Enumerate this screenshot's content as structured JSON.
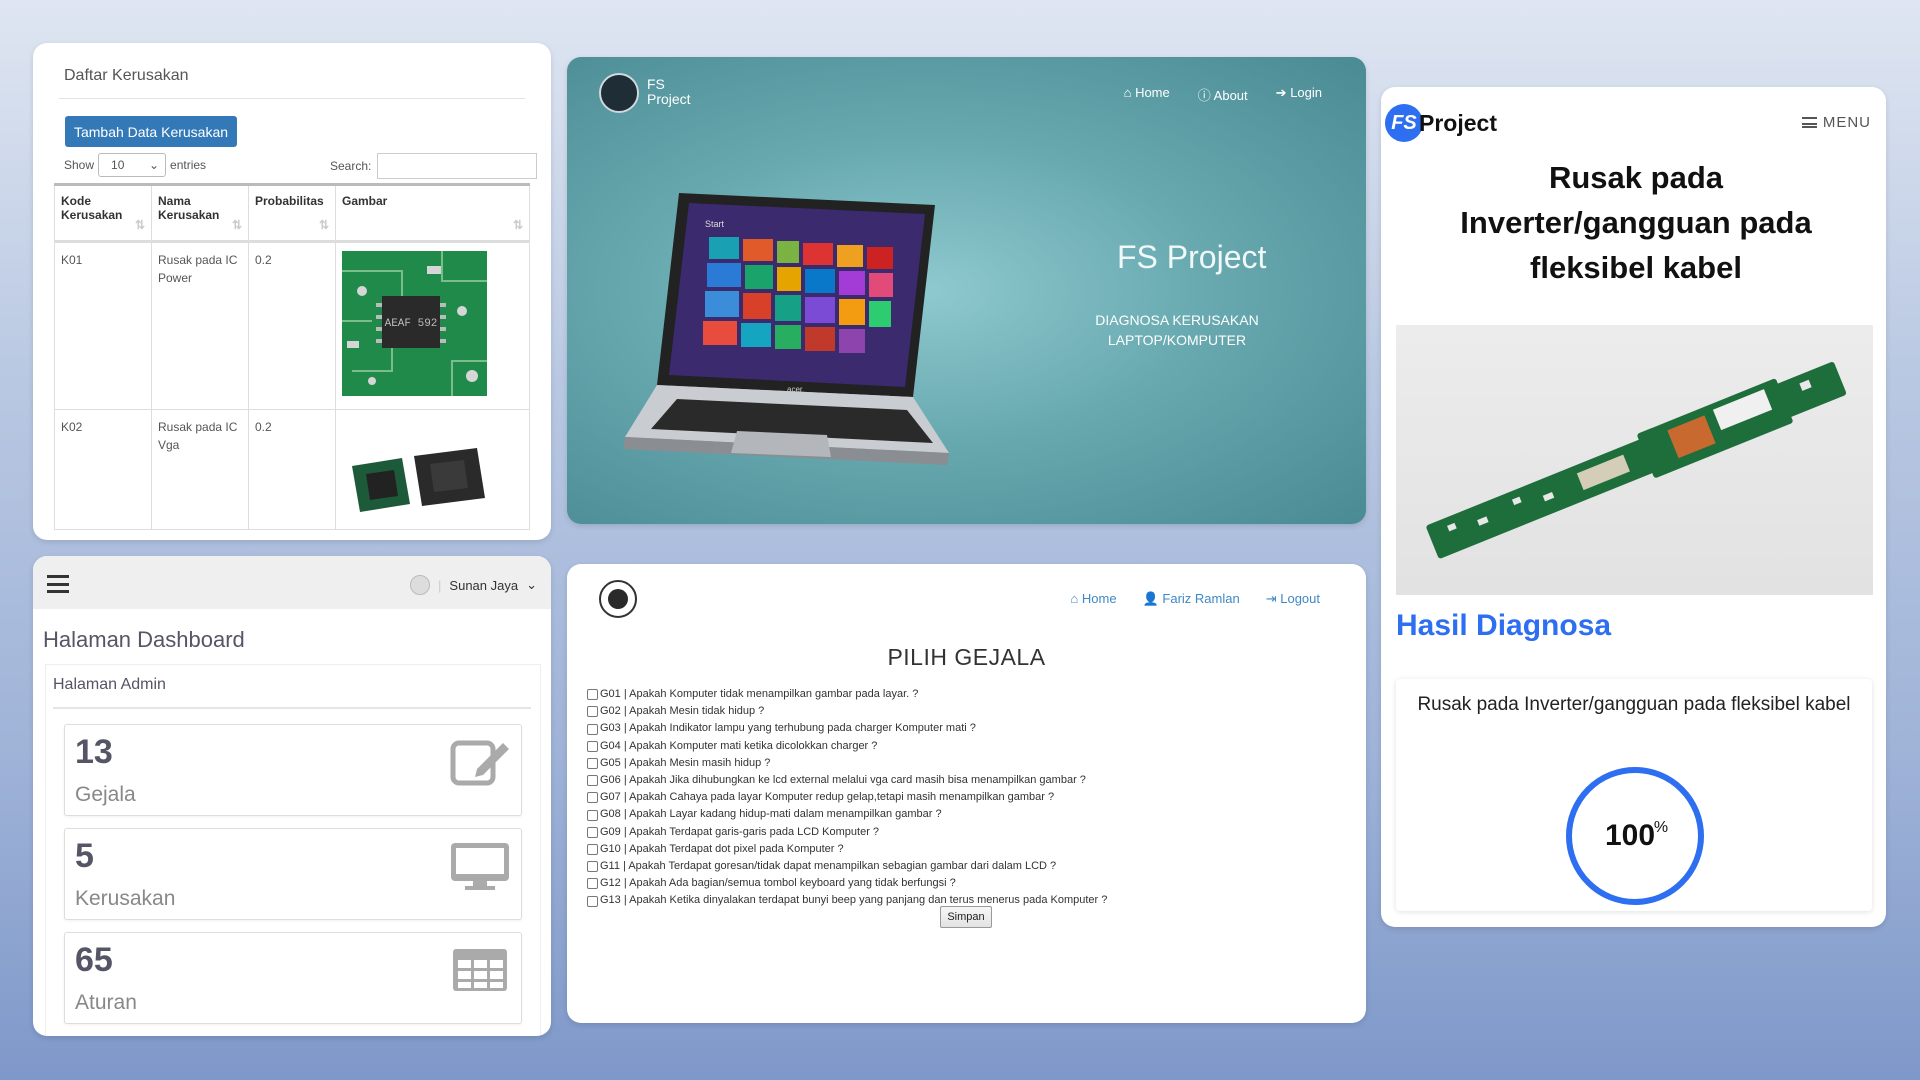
{
  "table_card": {
    "title": "Daftar Kerusakan",
    "add_button": "Tambah Data Kerusakan",
    "show_label": "Show",
    "show_value": "10",
    "entries_label": "entries",
    "search_label": "Search:",
    "columns": [
      "Kode Kerusakan",
      "Nama Kerusakan",
      "Probabilitas",
      "Gambar"
    ],
    "rows": [
      {
        "kode": "K01",
        "nama": "Rusak pada IC Power",
        "prob": "0.2",
        "chip_text": "AEAF 592"
      },
      {
        "kode": "K02",
        "nama": "Rusak pada IC Vga",
        "prob": "0.2"
      }
    ]
  },
  "hero_card": {
    "brand_line1": "FS",
    "brand_line2": "Project",
    "nav": [
      "Home",
      "About",
      "Login"
    ],
    "title": "FS Project",
    "subtitle_line1": "DIAGNOSA KERUSAKAN",
    "subtitle_line2": "LAPTOP/KOMPUTER",
    "laptop_brand": "acer",
    "screen_text": "Start"
  },
  "result_card": {
    "logo_letters": "FS",
    "logo_word": "Project",
    "menu_label": "MENU",
    "title": "Rusak pada Inverter/gangguan pada fleksibel kabel",
    "hasil_label": "Hasil Diagnosa",
    "result_text": "Rusak pada Inverter/gangguan pada fleksibel kabel",
    "percent": "100",
    "percent_sign": "%",
    "percent_fraction": 1.0,
    "accent": "#2d6ff0"
  },
  "dashboard_card": {
    "user": "Sunan Jaya",
    "title": "Halaman Dashboard",
    "subtitle": "Halaman Admin",
    "stats": [
      {
        "value": "13",
        "label": "Gejala",
        "icon": "edit-icon"
      },
      {
        "value": "5",
        "label": "Kerusakan",
        "icon": "monitor-icon"
      },
      {
        "value": "65",
        "label": "Aturan",
        "icon": "table-icon"
      }
    ]
  },
  "gejala_card": {
    "nav": [
      "Home",
      "Fariz Ramlan",
      "Logout"
    ],
    "title": "PILIH GEJALA",
    "items": [
      "G01 | Apakah Komputer tidak menampilkan gambar pada layar. ?",
      "G02 | Apakah Mesin tidak hidup ?",
      "G03 | Apakah Indikator lampu yang terhubung pada charger Komputer mati ?",
      "G04 | Apakah Komputer mati ketika dicolokkan charger ?",
      "G05 | Apakah Mesin masih hidup ?",
      "G06 | Apakah Jika dihubungkan ke lcd external melalui vga card masih bisa menampilkan gambar ?",
      "G07 | Apakah Cahaya pada layar Komputer redup gelap,tetapi masih menampilkan gambar ?",
      "G08 | Apakah Layar kadang hidup-mati dalam menampilkan gambar ?",
      "G09 | Apakah Terdapat garis-garis pada LCD Komputer ?",
      "G10 | Apakah Terdapat dot pixel pada Komputer ?",
      "G11 | Apakah Terdapat goresan/tidak dapat menampilkan sebagian gambar dari dalam LCD ?",
      "G12 | Apakah Ada bagian/semua tombol keyboard yang tidak berfungsi ?",
      "G13 | Apakah Ketika dinyalakan terdapat bunyi beep yang panjang dan terus menerus pada Komputer ?"
    ],
    "save_button": "Simpan"
  }
}
